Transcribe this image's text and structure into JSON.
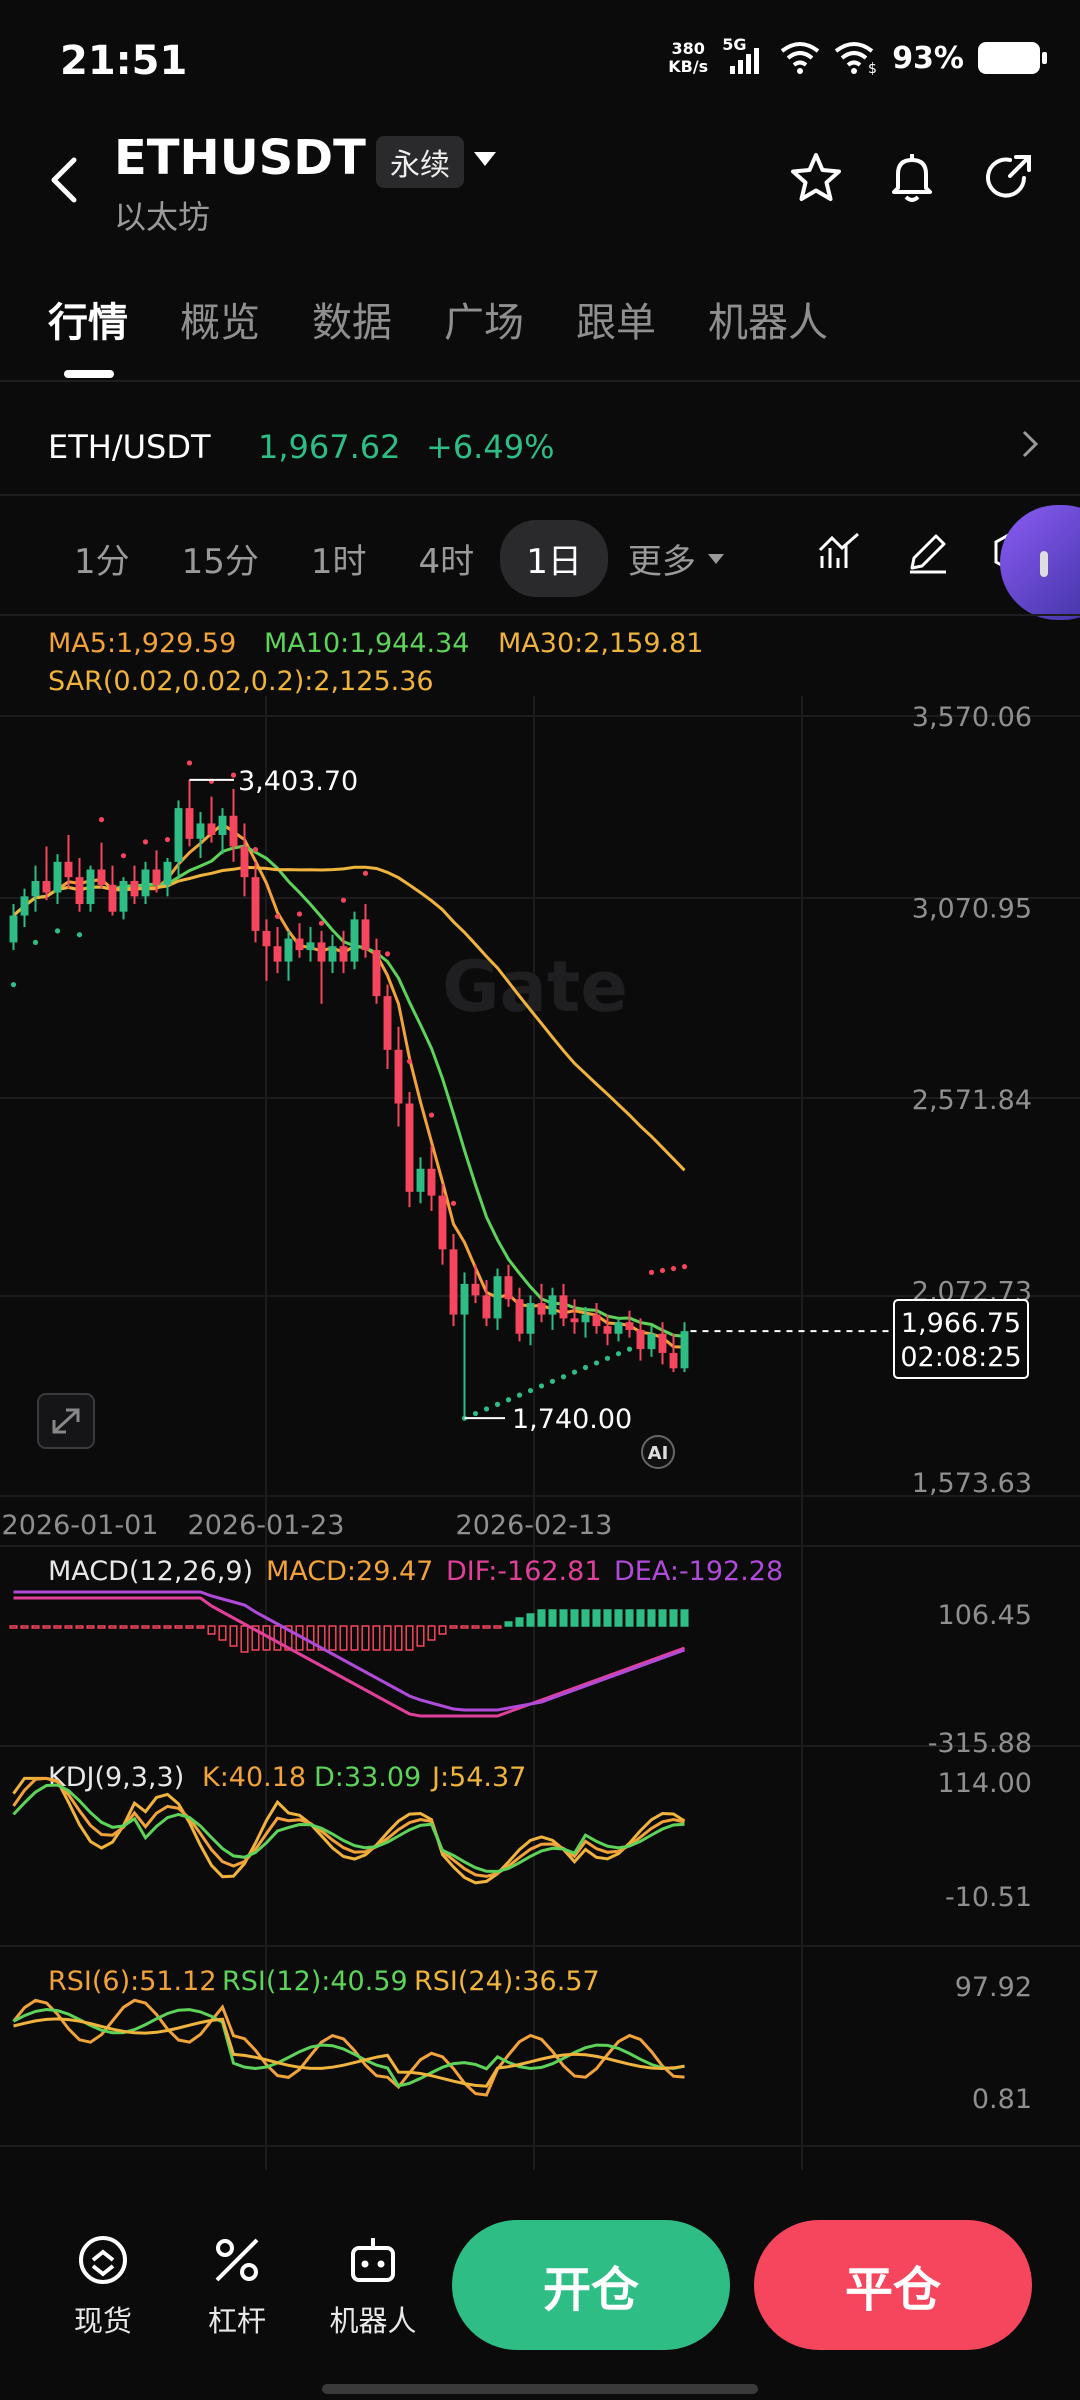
{
  "status_bar": {
    "time": "21:51",
    "net_speed_top": "380",
    "net_speed_bottom": "KB/s",
    "net_type": "5G",
    "battery_percent": "93%"
  },
  "header": {
    "pair": "ETHUSDT",
    "badge": "永续",
    "subtitle": "以太坊",
    "icons": [
      "back-icon",
      "star-icon",
      "bell-icon",
      "share-icon"
    ]
  },
  "tabs": [
    {
      "label": "行情",
      "active": true
    },
    {
      "label": "概览",
      "active": false
    },
    {
      "label": "数据",
      "active": false
    },
    {
      "label": "广场",
      "active": false
    },
    {
      "label": "跟单",
      "active": false
    },
    {
      "label": "机器人",
      "active": false
    }
  ],
  "ticker": {
    "name": "ETH/USDT",
    "price": "1,967.62",
    "change": "+6.49%"
  },
  "timeframes": {
    "items": [
      {
        "label": "1分",
        "active": false
      },
      {
        "label": "15分",
        "active": false
      },
      {
        "label": "1时",
        "active": false
      },
      {
        "label": "4时",
        "active": false
      },
      {
        "label": "1日",
        "active": true
      }
    ],
    "more": "更多"
  },
  "chart_data": {
    "type": "candlestick",
    "main": {
      "legend": {
        "ma5": "MA5:1,929.59",
        "ma10": "MA10:1,944.34",
        "ma30": "MA30:2,159.81",
        "sar": "SAR(0.02,0.02,0.2):2,125.36"
      },
      "y_ticks": [
        "3,570.06",
        "3,070.95",
        "2,571.84",
        "2,072.73",
        "1,573.63"
      ],
      "y_tick_values": [
        3570.06,
        3070.95,
        2571.84,
        2072.73,
        1573.63
      ],
      "ylim": [
        1573.63,
        3570.06
      ],
      "x_ticks": [
        "2026-01-01",
        "2026-01-23",
        "2026-02-13"
      ],
      "high_label": "3,403.70",
      "low_label": "1,740.00",
      "current_price": "1,966.75",
      "countdown": "02:08:25",
      "watermark": "Gate",
      "ai_badge": "AI",
      "candles_ohlc": [
        [
          2980,
          3080,
          2960,
          3050
        ],
        [
          3050,
          3120,
          3020,
          3100
        ],
        [
          3100,
          3180,
          3060,
          3140
        ],
        [
          3140,
          3230,
          3090,
          3110
        ],
        [
          3110,
          3210,
          3080,
          3190
        ],
        [
          3190,
          3260,
          3120,
          3150
        ],
        [
          3150,
          3200,
          3060,
          3080
        ],
        [
          3080,
          3180,
          3060,
          3170
        ],
        [
          3170,
          3240,
          3120,
          3130
        ],
        [
          3130,
          3180,
          3050,
          3060
        ],
        [
          3060,
          3150,
          3040,
          3140
        ],
        [
          3140,
          3180,
          3080,
          3100
        ],
        [
          3100,
          3190,
          3080,
          3170
        ],
        [
          3170,
          3220,
          3110,
          3130
        ],
        [
          3130,
          3200,
          3100,
          3190
        ],
        [
          3190,
          3350,
          3150,
          3330
        ],
        [
          3330,
          3403.7,
          3230,
          3250
        ],
        [
          3250,
          3320,
          3200,
          3290
        ],
        [
          3290,
          3360,
          3240,
          3260
        ],
        [
          3260,
          3330,
          3210,
          3310
        ],
        [
          3310,
          3380,
          3190,
          3230
        ],
        [
          3230,
          3290,
          3100,
          3150
        ],
        [
          3150,
          3190,
          2980,
          3010
        ],
        [
          3010,
          3040,
          2880,
          2970
        ],
        [
          2970,
          3020,
          2900,
          2930
        ],
        [
          2930,
          3010,
          2880,
          2990
        ],
        [
          2990,
          3030,
          2940,
          2960
        ],
        [
          2960,
          3020,
          2930,
          2980
        ],
        [
          2980,
          3010,
          2820,
          2930
        ],
        [
          2930,
          3000,
          2900,
          2970
        ],
        [
          2970,
          3010,
          2900,
          2930
        ],
        [
          2930,
          3060,
          2910,
          3040
        ],
        [
          3040,
          3080,
          2940,
          2960
        ],
        [
          2960,
          2990,
          2820,
          2840
        ],
        [
          2840,
          2870,
          2650,
          2700
        ],
        [
          2700,
          2760,
          2500,
          2560
        ],
        [
          2560,
          2590,
          2290,
          2330
        ],
        [
          2330,
          2420,
          2300,
          2390
        ],
        [
          2390,
          2450,
          2280,
          2320
        ],
        [
          2320,
          2350,
          2140,
          2180
        ],
        [
          2180,
          2220,
          1980,
          2010
        ],
        [
          2010,
          2120,
          1740,
          2090
        ],
        [
          2090,
          2140,
          2040,
          2060
        ],
        [
          2060,
          2100,
          1980,
          2000
        ],
        [
          2000,
          2130,
          1970,
          2110
        ],
        [
          2110,
          2140,
          2030,
          2050
        ],
        [
          2050,
          2080,
          1940,
          1960
        ],
        [
          1960,
          2060,
          1930,
          2040
        ],
        [
          2040,
          2090,
          1990,
          2010
        ],
        [
          2010,
          2080,
          1970,
          2060
        ],
        [
          2060,
          2090,
          1980,
          2000
        ],
        [
          2000,
          2050,
          1960,
          1990
        ],
        [
          1990,
          2030,
          1950,
          2010
        ],
        [
          2010,
          2040,
          1960,
          1980
        ],
        [
          1980,
          2010,
          1930,
          1960
        ],
        [
          1960,
          2000,
          1940,
          1990
        ],
        [
          1990,
          2020,
          1950,
          1970
        ],
        [
          1970,
          2000,
          1890,
          1920
        ],
        [
          1920,
          1980,
          1900,
          1960
        ],
        [
          1960,
          1990,
          1880,
          1910
        ],
        [
          1910,
          1960,
          1860,
          1870
        ],
        [
          1870,
          1990,
          1860,
          1966.75
        ]
      ],
      "colors": {
        "up": "#2ebd85",
        "down": "#f6465d",
        "ma5": "#f2a23a",
        "ma10": "#5ed35a",
        "ma30": "#f0b43c",
        "sar_up": "#2ebd85",
        "sar_down": "#f6465d"
      }
    },
    "macd": {
      "legend": {
        "name": "MACD(12,26,9)",
        "macd": "MACD:29.47",
        "dif": "DIF:-162.81",
        "dea": "DEA:-192.28"
      },
      "y_ticks": [
        "106.45",
        "-315.88"
      ],
      "ylim": [
        -315.88,
        106.45
      ],
      "colors": {
        "dif": "#e0409a",
        "dea": "#b04ad8",
        "macd": "#f2a23a"
      }
    },
    "kdj": {
      "legend": {
        "name": "KDJ(9,3,3)",
        "k": "K:40.18",
        "d": "D:33.09",
        "j": "J:54.37"
      },
      "y_ticks": [
        "114.00",
        "-10.51"
      ],
      "ylim": [
        -10.51,
        114.0
      ],
      "colors": {
        "k": "#f2a23a",
        "d": "#5ed35a",
        "j": "#f0b43c"
      }
    },
    "rsi": {
      "legend": {
        "r6": "RSI(6):51.12",
        "r12": "RSI(12):40.59",
        "r24": "RSI(24):36.57"
      },
      "y_ticks": [
        "97.92",
        "0.81"
      ],
      "ylim": [
        0.81,
        97.92
      ],
      "colors": {
        "r6": "#f2a23a",
        "r12": "#5ed35a",
        "r24": "#f0b43c"
      }
    }
  },
  "bottom_nav": {
    "items": [
      {
        "label": "现货",
        "icon": "spot-icon"
      },
      {
        "label": "杠杆",
        "icon": "leverage-icon"
      },
      {
        "label": "机器人",
        "icon": "robot-icon"
      }
    ],
    "open_label": "开仓",
    "close_label": "平仓"
  }
}
